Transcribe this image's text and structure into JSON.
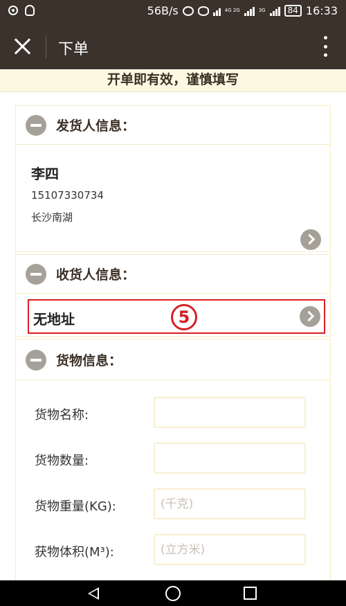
{
  "status_bar": {
    "net_speed": "56B/s",
    "network_small_1": "4G 2G",
    "network_small_2": "3G",
    "battery": "84",
    "time": "16:33"
  },
  "app_bar": {
    "title": "下单"
  },
  "notice": "开单即有效，谨慎填写",
  "sender": {
    "section_title": "发货人信息：",
    "name": "李四",
    "phone": "15107330734",
    "address": "长沙南湖"
  },
  "receiver": {
    "section_title": "收货人信息：",
    "address_text": "无地址",
    "step_mark": "5"
  },
  "cargo": {
    "section_title": "货物信息：",
    "fields": [
      {
        "label": "货物名称:",
        "placeholder": ""
      },
      {
        "label": "货物数量:",
        "placeholder": ""
      },
      {
        "label": "货物重量(KG):",
        "placeholder": "(千克)"
      },
      {
        "label": "获物体积(M³):",
        "placeholder": "(立方米)"
      }
    ]
  },
  "colors": {
    "bar_bg": "#3a322b",
    "notice_bg": "#fdf8e2",
    "accent_red": "#d61f26",
    "icon_gray": "#a6a198"
  }
}
